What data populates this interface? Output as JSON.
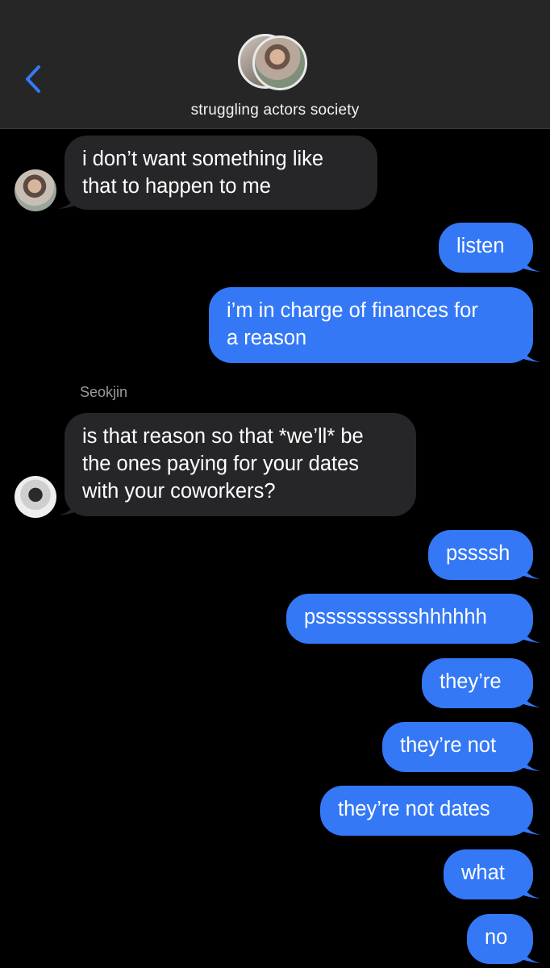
{
  "header": {
    "title": "struggling actors society",
    "back_icon": "chevron-left-icon",
    "accent_color": "#3478f6"
  },
  "colors": {
    "outgoing_bubble": "#3478f6",
    "incoming_bubble": "#262628",
    "background": "#000000"
  },
  "messages": [
    {
      "direction": "in",
      "text": "i don’t want something like\nthat to happen to me"
    },
    {
      "direction": "out",
      "text": "listen"
    },
    {
      "direction": "out",
      "text": "i’m in charge of finances for\na reason"
    },
    {
      "direction": "in",
      "sender": "Seokjin",
      "text": "is that reason so that *we’ll* be\nthe ones paying for your dates\nwith your coworkers?"
    },
    {
      "direction": "out",
      "text": "pssssh"
    },
    {
      "direction": "out",
      "text": "psssssssssshhhhhh"
    },
    {
      "direction": "out",
      "text": "they’re"
    },
    {
      "direction": "out",
      "text": "they’re not"
    },
    {
      "direction": "out",
      "text": "they’re not dates"
    },
    {
      "direction": "out",
      "text": "what"
    },
    {
      "direction": "out",
      "text": "no"
    }
  ]
}
